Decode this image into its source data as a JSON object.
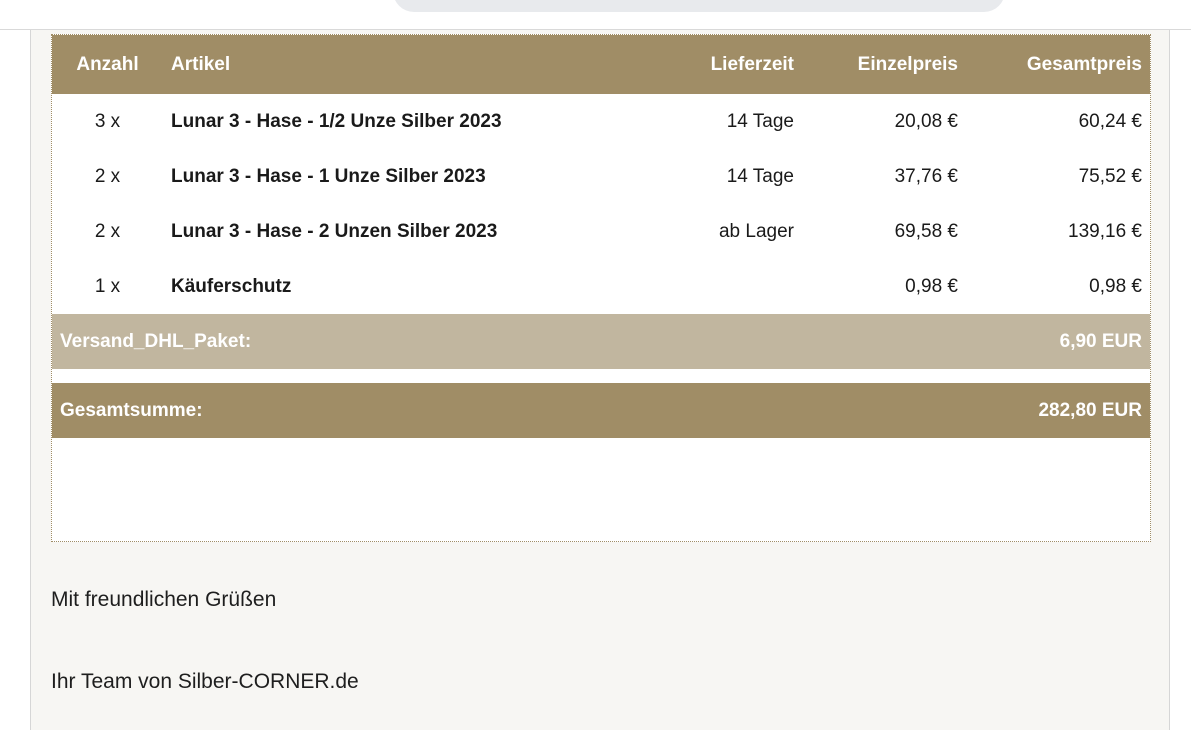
{
  "order_table": {
    "headers": {
      "anzahl": "Anzahl",
      "artikel": "Artikel",
      "lieferzeit": "Lieferzeit",
      "einzelpreis": "Einzelpreis",
      "gesamtpreis": "Gesamtpreis"
    },
    "rows": [
      {
        "qty": "3 x",
        "article": "Lunar 3 - Hase - 1/2 Unze Silber 2023",
        "delivery": "14 Tage",
        "unit_price": "20,08 €",
        "total_price": "60,24 €"
      },
      {
        "qty": "2 x",
        "article": "Lunar 3 - Hase - 1 Unze Silber 2023",
        "delivery": "14 Tage",
        "unit_price": "37,76 €",
        "total_price": "75,52 €"
      },
      {
        "qty": "2 x",
        "article": "Lunar 3 - Hase - 2 Unzen Silber 2023",
        "delivery": "ab Lager",
        "unit_price": "69,58 €",
        "total_price": "139,16 €"
      },
      {
        "qty": "1 x",
        "article": "Käuferschutz",
        "delivery": "",
        "unit_price": "0,98 €",
        "total_price": "0,98 €"
      }
    ],
    "shipping": {
      "label": "Versand_DHL_Paket:",
      "value": "6,90 EUR"
    },
    "total": {
      "label": "Gesamtsumme:",
      "value": "282,80 EUR"
    }
  },
  "footer": {
    "greeting": "Mit freundlichen Grüßen",
    "signature": "Ihr Team von Silber-CORNER.de"
  },
  "colors": {
    "header_bg": "#a08d66",
    "shipping_bg": "#c1b69f",
    "body_bg": "#f7f6f3"
  }
}
